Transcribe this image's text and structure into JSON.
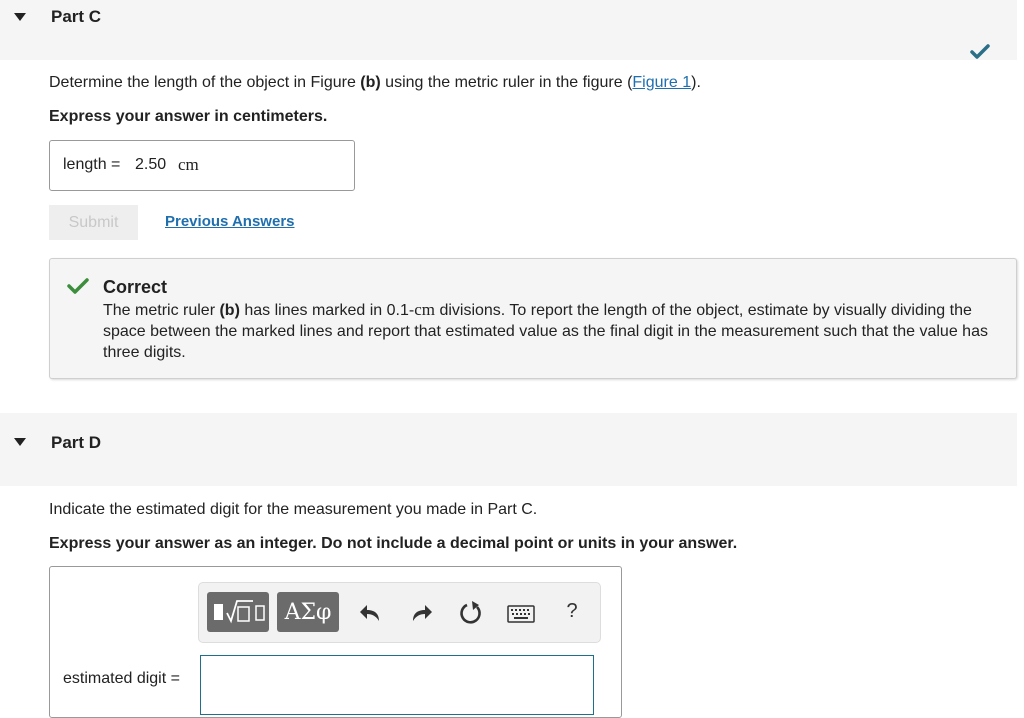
{
  "partC": {
    "title": "Part C",
    "question_pre": "Determine the length of the object in Figure ",
    "question_bold": "(b)",
    "question_mid": " using the metric ruler in the figure (",
    "figure_link": "Figure 1",
    "question_post": ").",
    "instruction": "Express your answer in centimeters.",
    "answer": {
      "label": "length =",
      "value": "2.50",
      "unit": "cm"
    },
    "submit_label": "Submit",
    "previous_answers_label": "Previous Answers",
    "feedback": {
      "title": "Correct",
      "body_1": "The metric ruler ",
      "body_bold": "(b)",
      "body_2": " has lines marked in 0.1-",
      "body_unit": "cm",
      "body_3": " divisions. To report the length of the object, estimate by visually dividing the space between the marked lines and report that estimated value as the final digit in the measurement such that the value has three digits."
    }
  },
  "partD": {
    "title": "Part D",
    "question": "Indicate the estimated digit for the measurement you made in Part C.",
    "instruction": "Express your answer as an integer. Do not include a decimal point or units in your answer.",
    "toolbar": {
      "greek_label": "ΑΣφ",
      "help_label": "?"
    },
    "answer_label": "estimated digit =",
    "answer_value": ""
  },
  "colors": {
    "correct_green": "#3c8d3c",
    "check_teal": "#2a6f87",
    "link_blue": "#1f6fae",
    "header_bg": "#f5f5f5"
  }
}
